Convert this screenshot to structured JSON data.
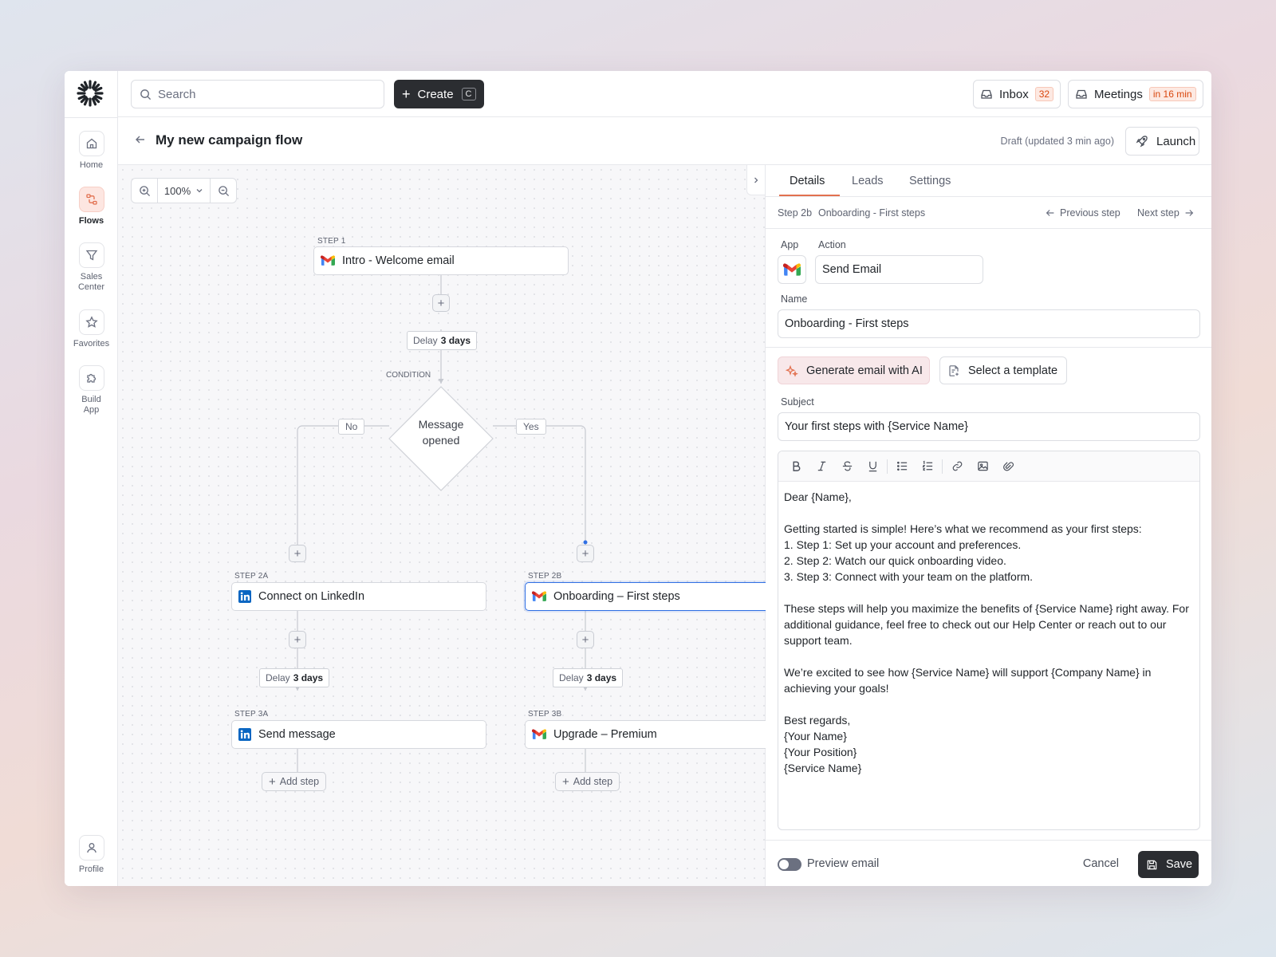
{
  "topbar": {
    "search_placeholder": "Search",
    "create_label": "Create",
    "create_shortcut": "C",
    "inbox_label": "Inbox",
    "inbox_count": "32",
    "meetings_label": "Meetings",
    "meetings_badge": "in 16 min"
  },
  "sidebar": {
    "items": [
      {
        "label": "Home",
        "icon": "home-icon"
      },
      {
        "label": "Flows",
        "icon": "flows-icon",
        "active": true
      },
      {
        "label": "Sales Center",
        "icon": "filter-icon"
      },
      {
        "label": "Favorites",
        "icon": "star-icon"
      },
      {
        "label": "Build App",
        "icon": "puzzle-icon"
      }
    ],
    "profile_label": "Profile"
  },
  "page": {
    "title": "My new campaign flow",
    "status": "Draft (updated 3 min ago)",
    "launch_label": "Launch"
  },
  "canvas": {
    "zoom_level": "100%",
    "condition_label": "CONDITION",
    "condition_text_1": "Message",
    "condition_text_2": "opened",
    "branch_no": "No",
    "branch_yes": "Yes",
    "delay_word": "Delay",
    "delay_value": "3 days",
    "add_step_label": "Add step",
    "steps": {
      "step1": {
        "label": "STEP 1",
        "title": "Intro - Welcome email",
        "app": "gmail"
      },
      "step2a": {
        "label": "STEP 2A",
        "title": "Connect on LinkedIn",
        "app": "linkedin"
      },
      "step2b": {
        "label": "STEP 2B",
        "title": "Onboarding – First steps",
        "app": "gmail"
      },
      "step3a": {
        "label": "STEP 3A",
        "title": "Send message",
        "app": "linkedin"
      },
      "step3b": {
        "label": "STEP 3B",
        "title": "Upgrade – Premium",
        "app": "gmail"
      }
    }
  },
  "panel": {
    "tabs": [
      "Details",
      "Leads",
      "Settings"
    ],
    "step_id": "Step 2b",
    "step_name": "Onboarding - First steps",
    "prev_label": "Previous step",
    "next_label": "Next step",
    "app_label": "App",
    "action_label": "Action",
    "action_value": "Send Email",
    "name_label": "Name",
    "name_value": "Onboarding - First steps",
    "ai_button": "Generate email with AI",
    "template_button": "Select a template",
    "subject_label": "Subject",
    "subject_value": "Your first steps with {Service Name}",
    "body": {
      "l1": "Dear {Name},",
      "l2": "",
      "l3": "Getting started is simple! Here’s what we recommend as your first steps:",
      "l4": "1. Step 1: Set up your account and preferences.",
      "l5": "2. Step 2: Watch our quick onboarding video.",
      "l6": "3. Step 3: Connect with your team on the platform.",
      "l7": "",
      "l8": "These steps will help you maximize the benefits of {Service Name} right away. For additional guidance, feel free to check out our Help Center or reach out to our support team.",
      "l9": "",
      "l10": "We’re excited to see how {Service Name} will support {Company Name} in achieving your goals!",
      "l11": "",
      "l12": "Best regards,",
      "l13": "{Your Name}",
      "l14": "{Your Position}",
      "l15": "{Service Name}"
    },
    "preview_label": "Preview email",
    "cancel_label": "Cancel",
    "save_label": "Save"
  },
  "colors": {
    "accent": "#e2704f",
    "selected_border": "#2f6fe4",
    "dark_button": "#2b2d31",
    "badge_text": "#d9480f"
  }
}
